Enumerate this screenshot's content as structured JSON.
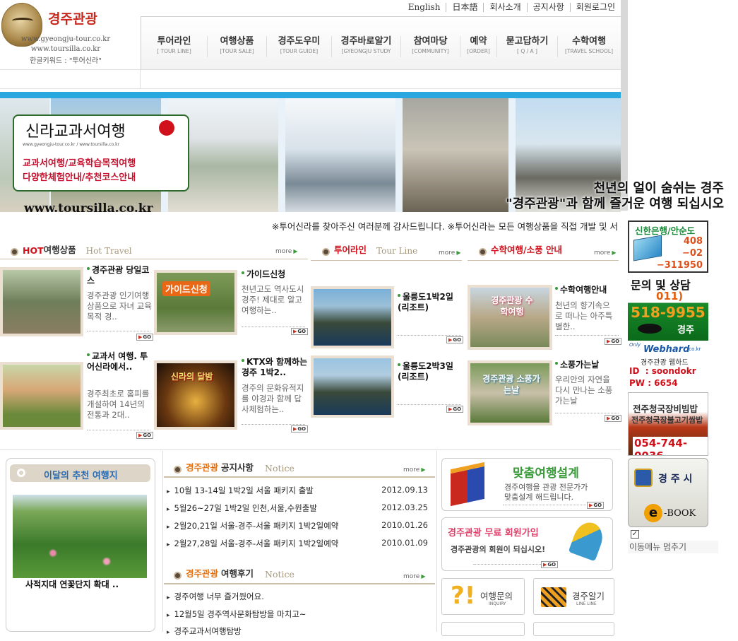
{
  "logo": {
    "title": "경주관광",
    "url1": "www.gyeongju-tour.co.kr",
    "url2": "www.toursilla.co.kr",
    "keyword": "한글키워드 : \"투어신라\""
  },
  "top_links": [
    "English",
    "日本語",
    "회사소개",
    "공지사항",
    "회원로그인"
  ],
  "nav": [
    {
      "kr": "투어라인",
      "en": "[ TOUR LINE]"
    },
    {
      "kr": "여행상품",
      "en": "[TOUR SALE]"
    },
    {
      "kr": "경주도우미",
      "en": "[TOUR GUIDE]"
    },
    {
      "kr": "경주바로알기",
      "en": "[GYEONGJU STUDY"
    },
    {
      "kr": "참여마당",
      "en": "[COMMUNITY]"
    },
    {
      "kr": "예약",
      "en": "[ORDER]"
    },
    {
      "kr": "묻고답하기",
      "en": "[ Q / A ]"
    },
    {
      "kr": "수학여행",
      "en": "[TRAVEL SCHOOL]"
    }
  ],
  "banner": {
    "box_title": "신라교과서여행",
    "box_urls": "www.gyeongju-tour.co.kr / www.toursilla.co.kr",
    "box_line1": "교과서여행/교육학습목적여행",
    "box_line2": "다양한체험안내/추천코스안내",
    "url": "www.toursilla.co.kr",
    "quote1": "천년의 얼이 숨쉬는 경주",
    "quote2": "\"경주관광\"과 함께 즐거운 여행 되십시오"
  },
  "marquee": "※투어신라를 찾아주신 여러분께 감사드립니다. ※투어신라는 모든 여행상품을 직접 개발 및 서",
  "sections": {
    "hot": {
      "title_red": "HOT",
      "title": "여행상품",
      "en": "Hot Travel",
      "more": "more"
    },
    "tourline": {
      "title": "투어라인",
      "en": "Tour Line",
      "more": "more"
    },
    "school": {
      "title": "수학여행/소풍 안내",
      "more": "more"
    }
  },
  "products": [
    {
      "title": "경주관광 당일코스",
      "desc": "경주관광 인기여행 상품으로 자녀 교육목적 경..",
      "go": "GO"
    },
    {
      "title": "가이드신청",
      "desc": "천년고도 역사도시 경주! 제대로 알고 여행하는..",
      "go": "GO",
      "thumb_text": "가이드신청"
    },
    {
      "title": "교과서 여행. 투어신라에서..",
      "desc": "경주최초로 홈피를 개설하여 14년의전통과 2대..",
      "go": "GO"
    },
    {
      "title": "KTX와 함께하는경주 1박2..",
      "desc": "경주의 문화유적지를 야경과 함께 답사체험하는..",
      "go": "GO",
      "thumb_text": "신라의 달밤"
    }
  ],
  "tourlines": [
    {
      "title": "울릉도1박2일 (리조트)",
      "go": "GO"
    },
    {
      "title": "울릉도2박3일 (리조트)",
      "go": "GO"
    }
  ],
  "school_items": [
    {
      "title": "수학여행안내",
      "desc": "천년의 향기속으로 떠나는 아주특별한..",
      "thumb_text": "경주관광 수학여행",
      "go": "GO"
    },
    {
      "title": "소풍가는날",
      "desc": "우리안의 자연을 다시 만나는 소풍가는날",
      "thumb_text": "경주관광 소풍가는날",
      "go": "GO"
    }
  ],
  "side": {
    "bank": "신한은행/안순도",
    "account1": "408",
    "account2": "−02",
    "account3": "−311950",
    "inquiry": "문의 및 상담",
    "phone_prefix": "011)",
    "phone": "518-9955",
    "phone_city": "경주",
    "webhard_only": "Only",
    "webhard": "Webhard",
    "webhard_tld": ".co.kr",
    "webhard_label": "경주관광 웹하드",
    "webhard_id": "ID  : soondokr",
    "webhard_pw": "PW : 6654",
    "rest1": "전주청국장비빔밥",
    "rest2": "전주청국장불고기쌈밥",
    "rest_phone": "054-744-0036",
    "city": "경 주 시",
    "ebook": "-BOOK",
    "ebook_e": "e",
    "stop_menu": "이동메뉴 멈추기"
  },
  "recommend": {
    "title": "이달의 추천 여행지",
    "caption": "사적지대 연꽃단지 확대 .."
  },
  "notice": {
    "title_color": "경주관광",
    "title": "공지사항",
    "en": "Notice",
    "more": "more",
    "rows": [
      {
        "text": "10월 13-14일 1박2일 서울 패키지 출발",
        "date": "2012.09.13"
      },
      {
        "text": "5월26~27일 1박2일 인천,서울,수원출발",
        "date": "2012.03.25"
      },
      {
        "text": "2월20,21일 서울-경주-서울 패키지 1박2일예약",
        "date": "2010.01.26"
      },
      {
        "text": "2월27,28일 서울-경주-서울 패키지 1박2일예약",
        "date": "2010.01.09"
      }
    ]
  },
  "review": {
    "title_color": "경주관광",
    "title": "여행후기",
    "en": "Notice",
    "more": "more",
    "rows": [
      "경주여행 너무 즐거웠어요.",
      "12월5일 경주역사문화탐방을 마치고~",
      "경주교과서여행탐방"
    ]
  },
  "custom": {
    "title": "맞춤여행설계",
    "desc1": "경주여행을 관광 전문가가",
    "desc2": "맞춤설계 해드립니다.",
    "go": "GO"
  },
  "signup": {
    "title": "경주관광 무료 회원가입",
    "desc": "경주관광의 회원이 되십시오!",
    "go": "GO"
  },
  "quick": [
    {
      "kr": "여행문의",
      "en": "INQUIRY"
    },
    {
      "kr": "경주알기",
      "en": "LINE LINE"
    }
  ]
}
